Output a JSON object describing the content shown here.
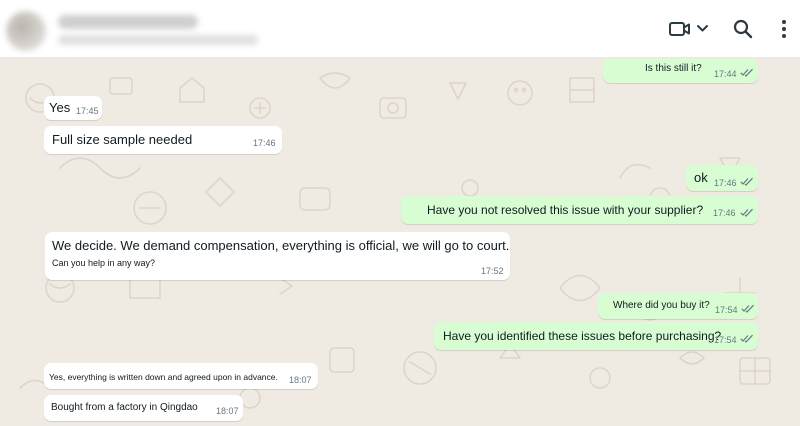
{
  "header": {
    "icons": [
      "video-call-icon",
      "chevron-down-icon",
      "search-icon",
      "menu-icon"
    ]
  },
  "colors": {
    "incoming_bubble": "#ffffff",
    "outgoing_bubble": "#d9fdd3",
    "chat_background": "#efeae2",
    "read_ticks": "#667781"
  },
  "messages": [
    {
      "direction": "out",
      "text": "Is this still it?",
      "time": "17:44",
      "status": "read"
    },
    {
      "direction": "in",
      "text": "Yes",
      "time": "17:45"
    },
    {
      "direction": "in",
      "text": "Full size sample needed",
      "time": "17:46"
    },
    {
      "direction": "out",
      "text": "ok",
      "time": "17:46",
      "status": "read"
    },
    {
      "direction": "out",
      "text": "Have you not resolved this issue with your supplier?",
      "time": "17:46",
      "status": "read"
    },
    {
      "direction": "in",
      "text": "We decide. We demand compensation, everything is official, we will go to court.",
      "subtext": "Can you help in any way?",
      "time": "17:52"
    },
    {
      "direction": "out",
      "text": "Where did you buy it?",
      "time": "17:54",
      "status": "read"
    },
    {
      "direction": "out",
      "text": "Have you identified these issues before purchasing?",
      "time": "17:54",
      "status": "read"
    },
    {
      "direction": "in",
      "text": "Yes, everything is written down and agreed upon in advance.",
      "time": "18:07"
    },
    {
      "direction": "in",
      "text": "Bought from a factory in Qingdao",
      "time": "18:07"
    }
  ]
}
